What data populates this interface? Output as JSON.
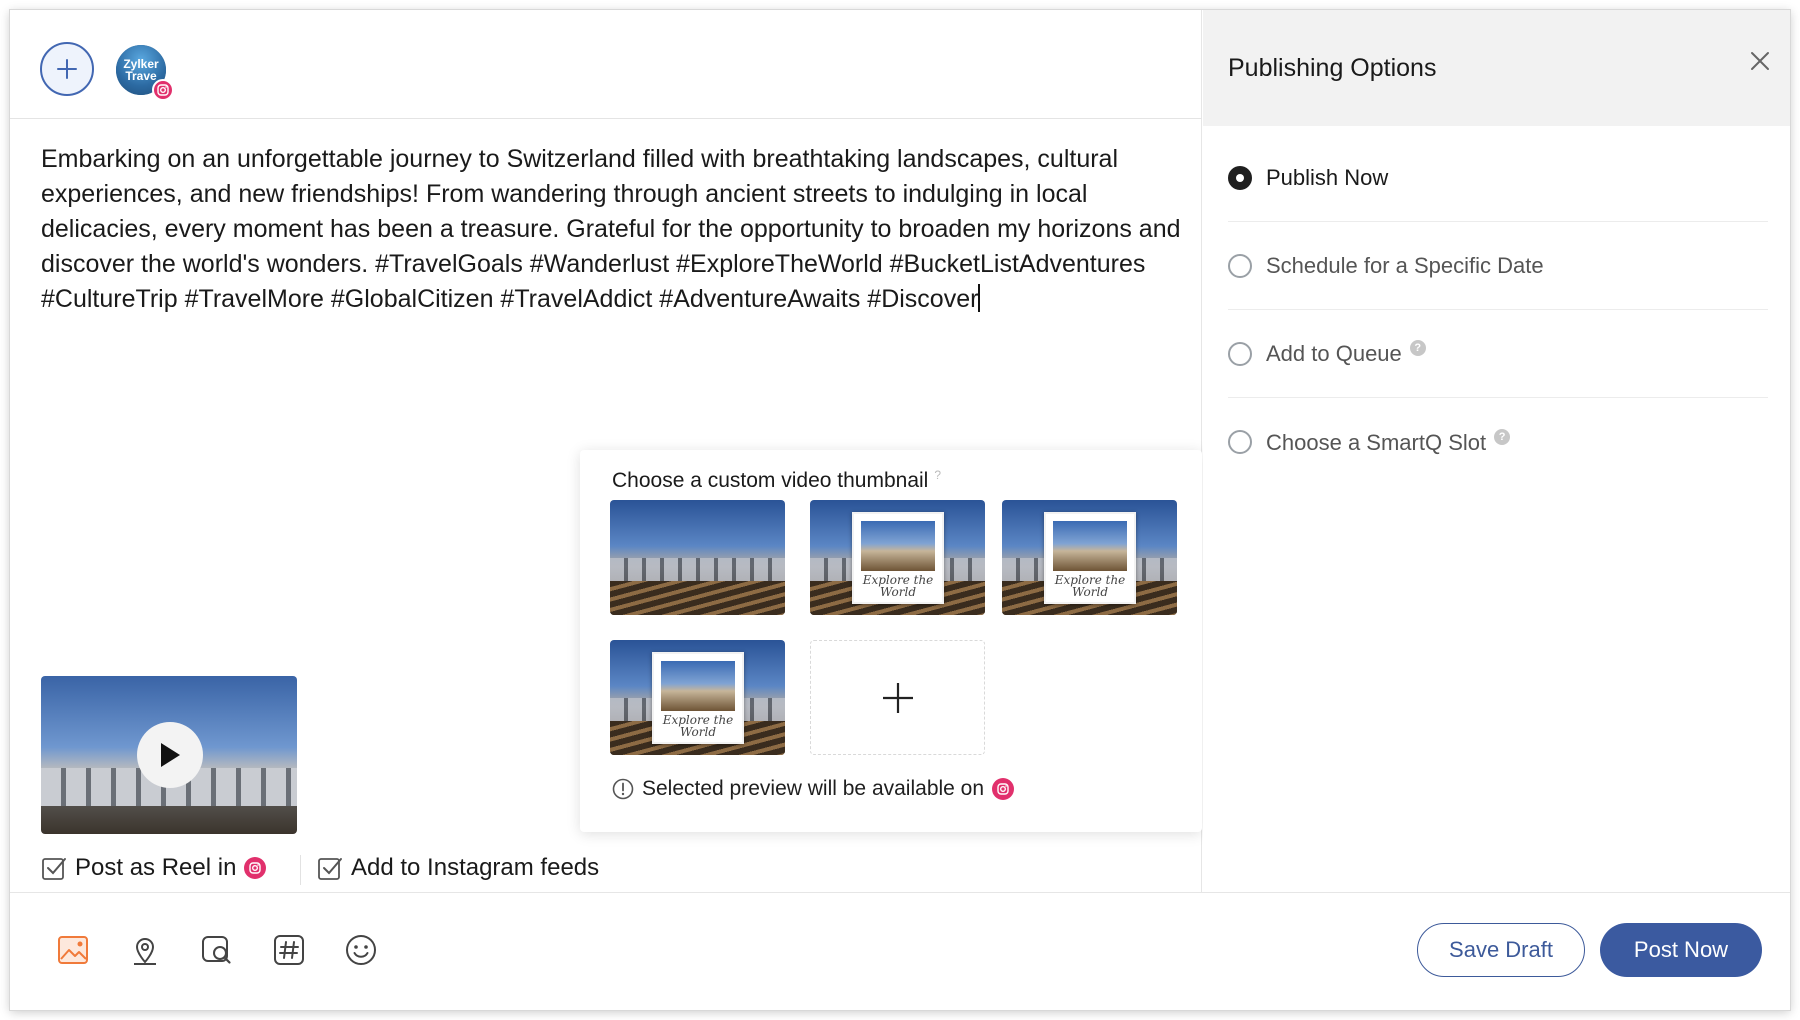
{
  "account": {
    "avatar_line1": "Zylker",
    "avatar_line2": "Trave"
  },
  "post": {
    "text": "Embarking on an unforgettable journey to Switzerland filled with breathtaking landscapes, cultural experiences, and new friendships! From wandering through ancient streets to indulging in local delicacies, every moment has been a treasure. Grateful for the opportunity to broaden my horizons and discover the world's wonders. #TravelGoals #Wanderlust #ExploreTheWorld #BucketListAdventures #CultureTrip #TravelMore #GlobalCitizen #TravelAddict #AdventureAwaits #Discover"
  },
  "thumbnail_panel": {
    "title": "Choose a custom video thumbnail",
    "help": "?",
    "card_caption_line1": "Explore the",
    "card_caption_line2": "World",
    "note": "Selected preview will be available on"
  },
  "options_below_video": {
    "post_as_reel": "Post as Reel in",
    "add_to_feeds": "Add to Instagram feeds"
  },
  "publishing": {
    "title": "Publishing Options",
    "options": [
      {
        "label": "Publish Now",
        "checked": true
      },
      {
        "label": "Schedule for a Specific Date",
        "checked": false
      },
      {
        "label": "Add to Queue",
        "checked": false
      },
      {
        "label": "Choose a SmartQ Slot",
        "checked": false
      }
    ],
    "help_glyph": "?"
  },
  "footer": {
    "save_draft": "Save Draft",
    "post_now": "Post Now",
    "tools": [
      "image-icon",
      "location-icon",
      "search-image-icon",
      "hashtag-icon",
      "emoji-icon"
    ]
  },
  "colors": {
    "brand": "#3b5aa0",
    "instagram": "#e1306c",
    "image_tool": "#f07a3a"
  }
}
